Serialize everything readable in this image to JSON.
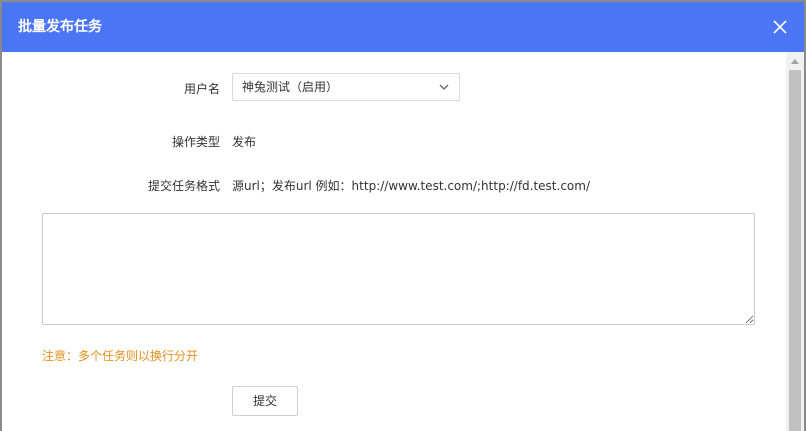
{
  "dialog": {
    "title": "批量发布任务",
    "close_icon": "close-icon"
  },
  "form": {
    "username_label": "用户名",
    "username_value": "神兔测试（启用）",
    "operation_label": "操作类型",
    "operation_value": "发布",
    "format_label": "提交任务格式",
    "format_value": "源url；发布url 例如：http://www.test.com/;http://fd.test.com/",
    "tasks_value": "",
    "note": "注意：多个任务则以换行分开",
    "submit_label": "提交"
  },
  "colors": {
    "titlebar": "#4a75f5",
    "note": "#e48f1a"
  }
}
